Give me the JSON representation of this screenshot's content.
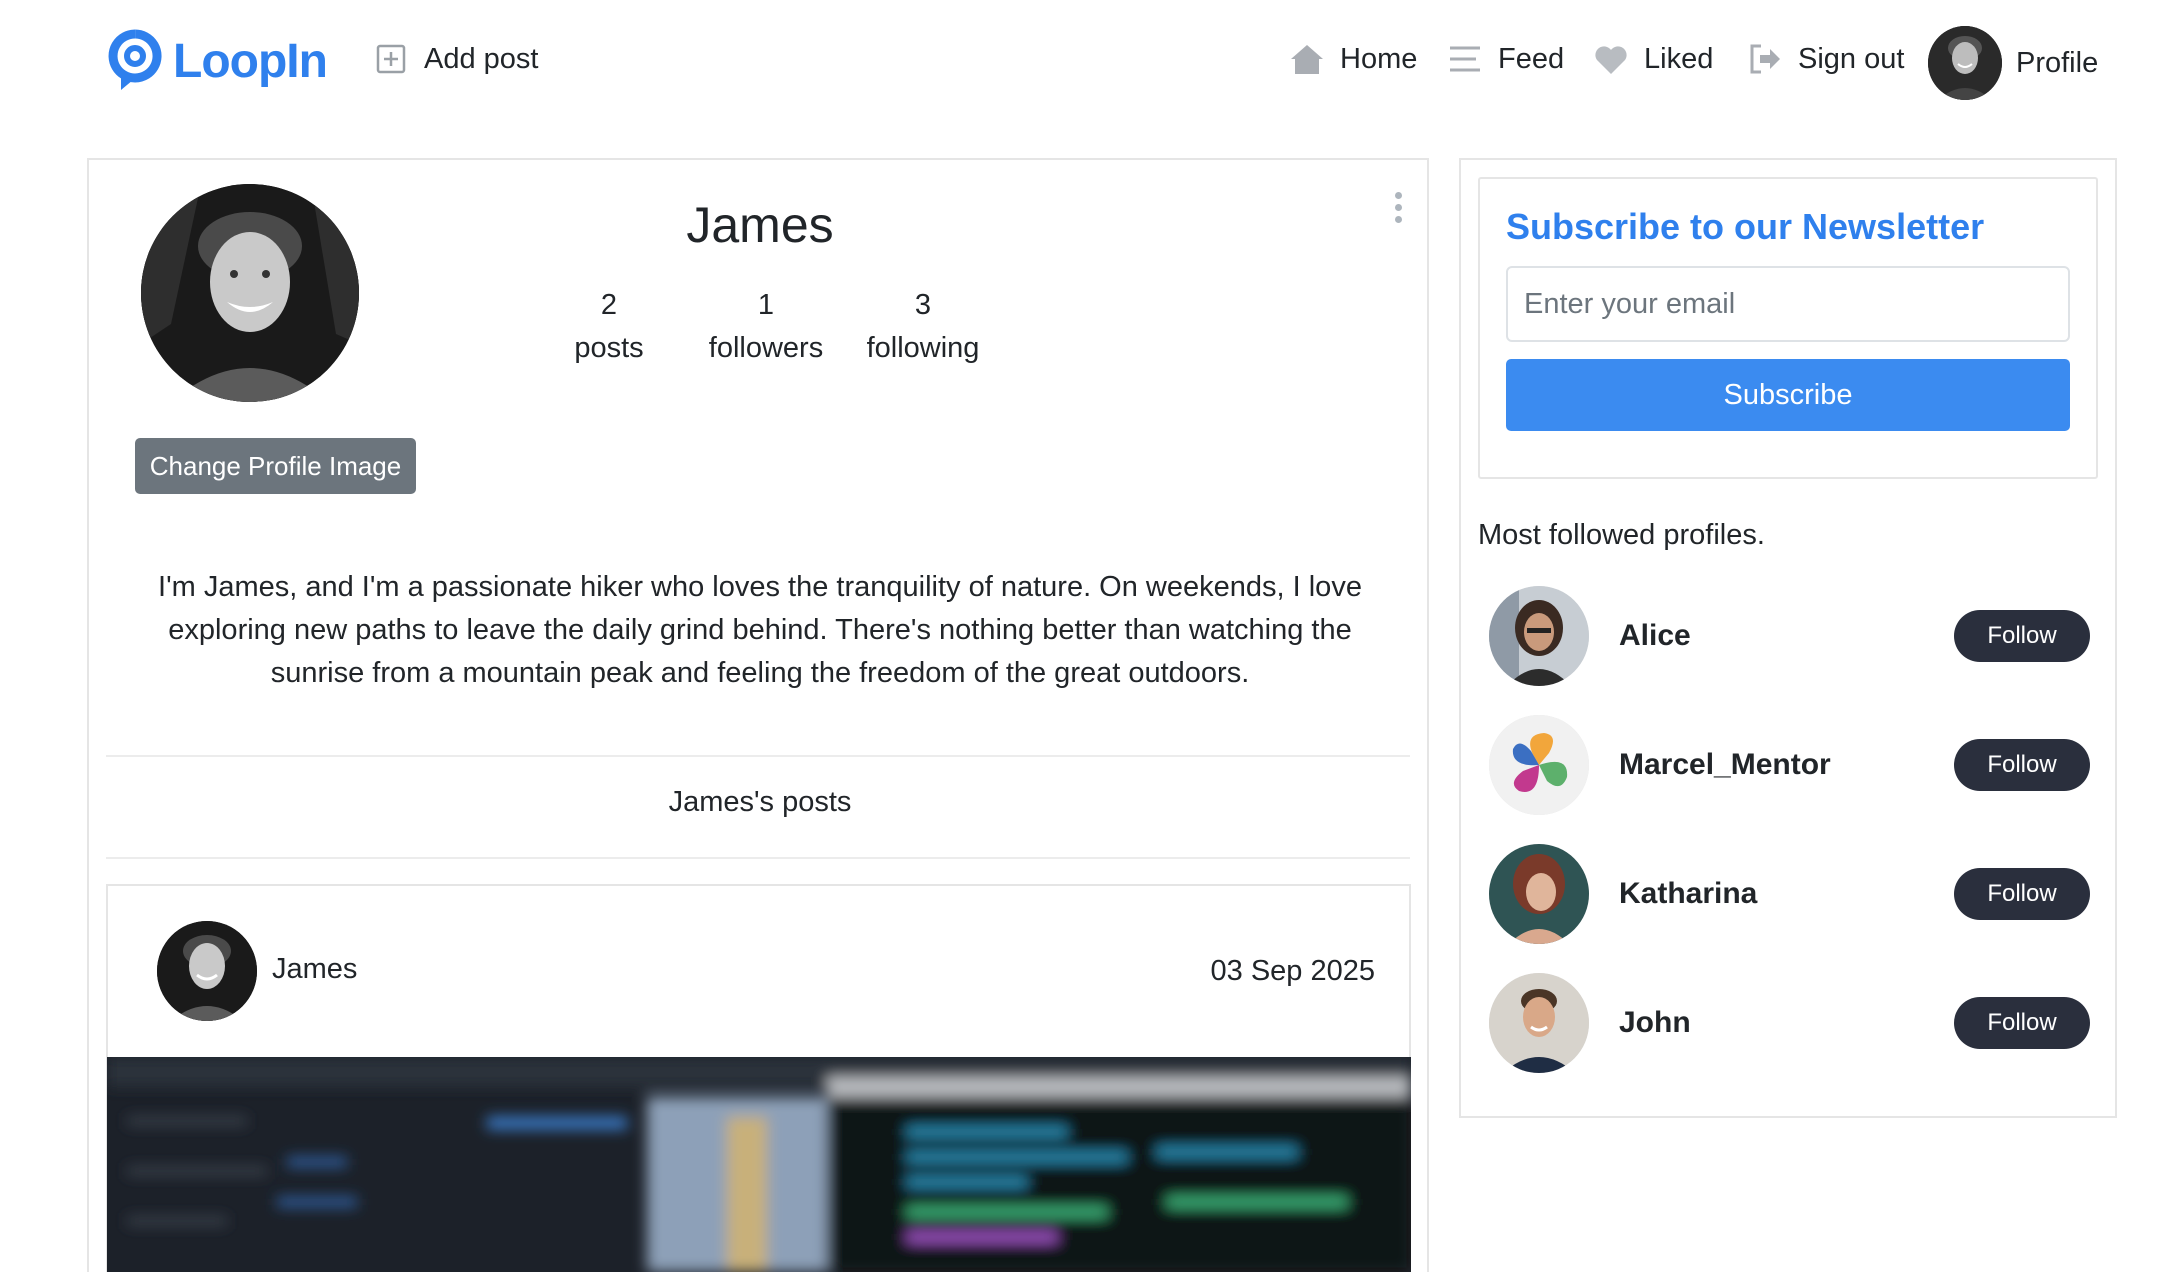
{
  "nav": {
    "brand": "LoopIn",
    "add_post": "Add post",
    "home": "Home",
    "feed": "Feed",
    "liked": "Liked",
    "sign_out": "Sign out",
    "profile": "Profile"
  },
  "profile": {
    "name": "James",
    "stats": [
      {
        "value": "2",
        "label": "posts"
      },
      {
        "value": "1",
        "label": "followers"
      },
      {
        "value": "3",
        "label": "following"
      }
    ],
    "change_image_label": "Change Profile Image",
    "bio": "I'm James, and I'm a passionate hiker who loves the tranquility of nature. On weekends, I love exploring new paths to leave the daily grind behind. There's nothing better than watching the sunrise from a mountain peak and feeling the freedom of the great outdoors.",
    "posts_heading": "James's posts"
  },
  "post": {
    "author": "James",
    "date": "03 Sep 2025"
  },
  "newsletter": {
    "title": "Subscribe to our Newsletter",
    "email_placeholder": "Enter your email",
    "button": "Subscribe"
  },
  "suggestions": {
    "heading": "Most followed profiles.",
    "follow_label": "Follow",
    "items": [
      {
        "name": "Alice"
      },
      {
        "name": "Marcel_Mentor"
      },
      {
        "name": "Katharina"
      },
      {
        "name": "John"
      }
    ]
  },
  "colors": {
    "brand": "#2f80ed",
    "subscribe": "#3b8bf0",
    "follow": "#2a2f3d",
    "secondary_button": "#6c757d"
  }
}
